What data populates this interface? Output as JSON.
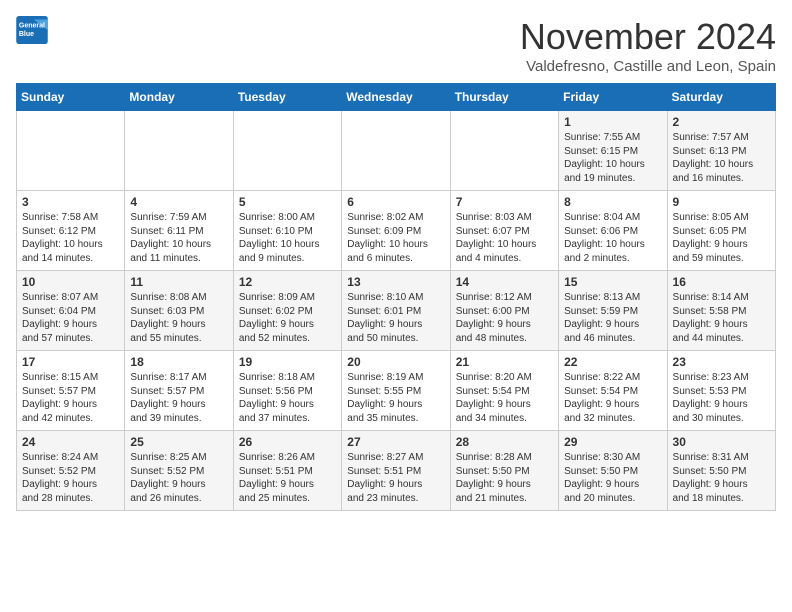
{
  "logo": {
    "line1": "General",
    "line2": "Blue"
  },
  "title": "November 2024",
  "subtitle": "Valdefresno, Castille and Leon, Spain",
  "weekdays": [
    "Sunday",
    "Monday",
    "Tuesday",
    "Wednesday",
    "Thursday",
    "Friday",
    "Saturday"
  ],
  "weeks": [
    [
      {
        "day": "",
        "info": ""
      },
      {
        "day": "",
        "info": ""
      },
      {
        "day": "",
        "info": ""
      },
      {
        "day": "",
        "info": ""
      },
      {
        "day": "",
        "info": ""
      },
      {
        "day": "1",
        "info": "Sunrise: 7:55 AM\nSunset: 6:15 PM\nDaylight: 10 hours\nand 19 minutes."
      },
      {
        "day": "2",
        "info": "Sunrise: 7:57 AM\nSunset: 6:13 PM\nDaylight: 10 hours\nand 16 minutes."
      }
    ],
    [
      {
        "day": "3",
        "info": "Sunrise: 7:58 AM\nSunset: 6:12 PM\nDaylight: 10 hours\nand 14 minutes."
      },
      {
        "day": "4",
        "info": "Sunrise: 7:59 AM\nSunset: 6:11 PM\nDaylight: 10 hours\nand 11 minutes."
      },
      {
        "day": "5",
        "info": "Sunrise: 8:00 AM\nSunset: 6:10 PM\nDaylight: 10 hours\nand 9 minutes."
      },
      {
        "day": "6",
        "info": "Sunrise: 8:02 AM\nSunset: 6:09 PM\nDaylight: 10 hours\nand 6 minutes."
      },
      {
        "day": "7",
        "info": "Sunrise: 8:03 AM\nSunset: 6:07 PM\nDaylight: 10 hours\nand 4 minutes."
      },
      {
        "day": "8",
        "info": "Sunrise: 8:04 AM\nSunset: 6:06 PM\nDaylight: 10 hours\nand 2 minutes."
      },
      {
        "day": "9",
        "info": "Sunrise: 8:05 AM\nSunset: 6:05 PM\nDaylight: 9 hours\nand 59 minutes."
      }
    ],
    [
      {
        "day": "10",
        "info": "Sunrise: 8:07 AM\nSunset: 6:04 PM\nDaylight: 9 hours\nand 57 minutes."
      },
      {
        "day": "11",
        "info": "Sunrise: 8:08 AM\nSunset: 6:03 PM\nDaylight: 9 hours\nand 55 minutes."
      },
      {
        "day": "12",
        "info": "Sunrise: 8:09 AM\nSunset: 6:02 PM\nDaylight: 9 hours\nand 52 minutes."
      },
      {
        "day": "13",
        "info": "Sunrise: 8:10 AM\nSunset: 6:01 PM\nDaylight: 9 hours\nand 50 minutes."
      },
      {
        "day": "14",
        "info": "Sunrise: 8:12 AM\nSunset: 6:00 PM\nDaylight: 9 hours\nand 48 minutes."
      },
      {
        "day": "15",
        "info": "Sunrise: 8:13 AM\nSunset: 5:59 PM\nDaylight: 9 hours\nand 46 minutes."
      },
      {
        "day": "16",
        "info": "Sunrise: 8:14 AM\nSunset: 5:58 PM\nDaylight: 9 hours\nand 44 minutes."
      }
    ],
    [
      {
        "day": "17",
        "info": "Sunrise: 8:15 AM\nSunset: 5:57 PM\nDaylight: 9 hours\nand 42 minutes."
      },
      {
        "day": "18",
        "info": "Sunrise: 8:17 AM\nSunset: 5:57 PM\nDaylight: 9 hours\nand 39 minutes."
      },
      {
        "day": "19",
        "info": "Sunrise: 8:18 AM\nSunset: 5:56 PM\nDaylight: 9 hours\nand 37 minutes."
      },
      {
        "day": "20",
        "info": "Sunrise: 8:19 AM\nSunset: 5:55 PM\nDaylight: 9 hours\nand 35 minutes."
      },
      {
        "day": "21",
        "info": "Sunrise: 8:20 AM\nSunset: 5:54 PM\nDaylight: 9 hours\nand 34 minutes."
      },
      {
        "day": "22",
        "info": "Sunrise: 8:22 AM\nSunset: 5:54 PM\nDaylight: 9 hours\nand 32 minutes."
      },
      {
        "day": "23",
        "info": "Sunrise: 8:23 AM\nSunset: 5:53 PM\nDaylight: 9 hours\nand 30 minutes."
      }
    ],
    [
      {
        "day": "24",
        "info": "Sunrise: 8:24 AM\nSunset: 5:52 PM\nDaylight: 9 hours\nand 28 minutes."
      },
      {
        "day": "25",
        "info": "Sunrise: 8:25 AM\nSunset: 5:52 PM\nDaylight: 9 hours\nand 26 minutes."
      },
      {
        "day": "26",
        "info": "Sunrise: 8:26 AM\nSunset: 5:51 PM\nDaylight: 9 hours\nand 25 minutes."
      },
      {
        "day": "27",
        "info": "Sunrise: 8:27 AM\nSunset: 5:51 PM\nDaylight: 9 hours\nand 23 minutes."
      },
      {
        "day": "28",
        "info": "Sunrise: 8:28 AM\nSunset: 5:50 PM\nDaylight: 9 hours\nand 21 minutes."
      },
      {
        "day": "29",
        "info": "Sunrise: 8:30 AM\nSunset: 5:50 PM\nDaylight: 9 hours\nand 20 minutes."
      },
      {
        "day": "30",
        "info": "Sunrise: 8:31 AM\nSunset: 5:50 PM\nDaylight: 9 hours\nand 18 minutes."
      }
    ]
  ]
}
